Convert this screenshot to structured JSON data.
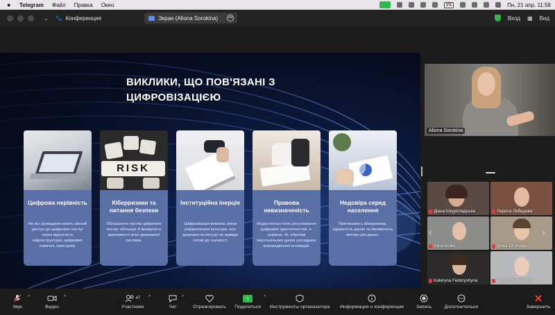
{
  "menubar": {
    "app_name": "Telegram",
    "items": [
      "Файл",
      "Правка",
      "Окно"
    ],
    "keyboard": "УК",
    "clock": "Пн, 21 апр.  11:58"
  },
  "window": {
    "conference_label": "Конференция",
    "share_label": "Экран (Aliona Sorokina)",
    "login_label": "Вход",
    "view_label": "Вид"
  },
  "slide": {
    "title": "ВИКЛИКИ, ЩО ПОВ'ЯЗАНІ З ЦИФРОВІЗАЦІЄЮ",
    "cards": [
      {
        "heading": "Цифрова нерівність",
        "body": "Не всі громадяни мають рівний доступ до цифрових послуг через відсутність інфраструктури, цифрових навичок, пристроїв."
      },
      {
        "heading": "Кіберризики та питання безпеки",
        "body": "Збільшення частки цифрових послуг збільшує й імовірність вразливості всієї державної системи."
      },
      {
        "heading": "Інституційна інерція",
        "body": "Цифровізація вимагає зміни управлінської культури, але державні інституції не завжди готові до гнучкості"
      },
      {
        "heading": "Правова невизначеність",
        "body": "Недостатньо чітке регулювання цифрових ідентичностей, е-сервісів, AI, обробки персональних даних ускладнює впровадження інновацій."
      },
      {
        "heading": "Недовіра серед населення",
        "body": "Причинами є кіберризики, відкритість даних та ймовірність витоку цих даних."
      }
    ]
  },
  "speaker": {
    "name": "Aliona Sorokina"
  },
  "participants": [
    {
      "name": "Діана Шкуропадська"
    },
    {
      "name": "Лариса Лебедева"
    },
    {
      "name": "Alina Boiko"
    },
    {
      "name": "Ірина Штундер"
    },
    {
      "name": "Kateryna Fedoryshyna"
    },
    {
      "name": "Andrii Shynkovych"
    }
  ],
  "toolbar": {
    "audio": "Звук",
    "video": "Видео",
    "participants": "Участники",
    "participants_count": "47",
    "chat": "Чат",
    "react": "Отреагировать",
    "share": "Поделиться",
    "host_tools": "Инструменты организатора",
    "info": "Информация о конференции",
    "record": "Запись",
    "more": "Дополнительно",
    "end": "Завершить"
  }
}
